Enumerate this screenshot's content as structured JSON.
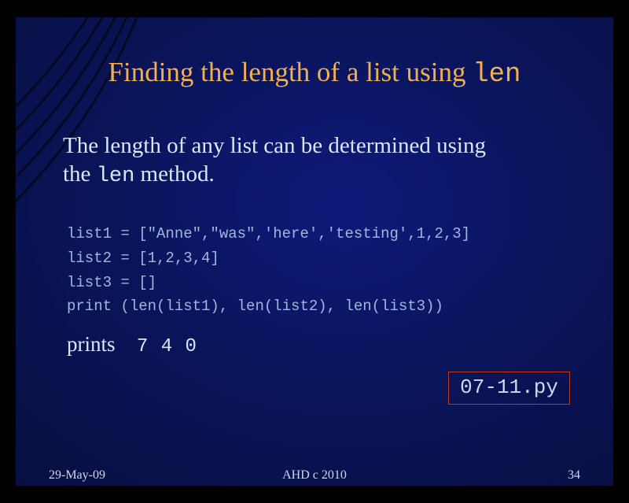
{
  "title": {
    "prefix": "Finding the length of a list using ",
    "code": "len"
  },
  "body": {
    "line1_prefix": "The length of any list can be determined using",
    "line2_prefix": "the ",
    "line2_code": "len",
    "line2_suffix": " method."
  },
  "code": {
    "l1": "list1 = [\"Anne\",\"was\",'here','testing',1,2,3]",
    "l2": "list2 = [1,2,3,4]",
    "l3": "list3 = []",
    "l4": "print (len(list1), len(list2), len(list3))"
  },
  "prints": {
    "label": "prints",
    "output": "  7   4   0"
  },
  "filebox": "07-11.py",
  "footer": {
    "left": "29-May-09",
    "center": "AHD  c  2010",
    "right": "34"
  },
  "colors": {
    "title": "#f0b050",
    "text": "#d9e7ff",
    "code": "#9eb6e0",
    "box_border": "#b73a1f",
    "bg_center": "#0e1a7a",
    "bg_edge": "#040826"
  }
}
